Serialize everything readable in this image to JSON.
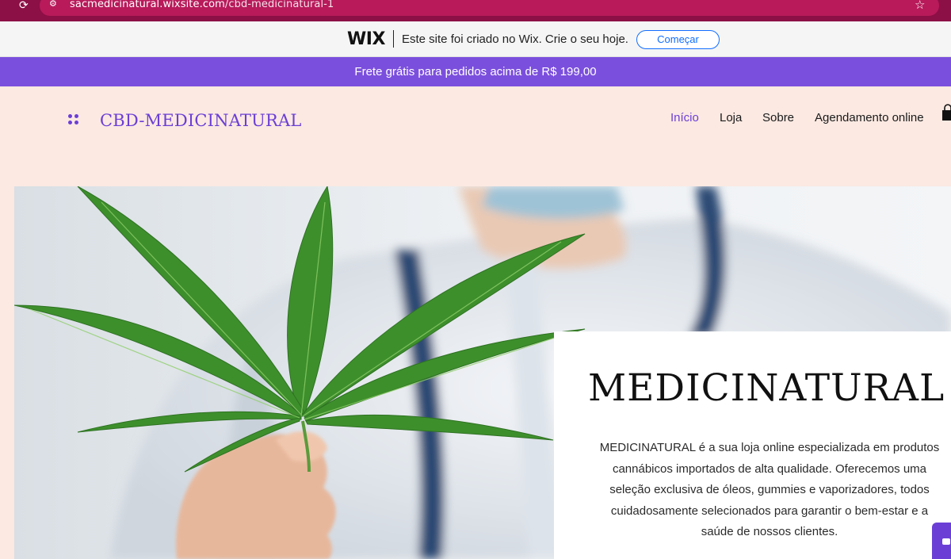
{
  "browser": {
    "url_host": "sacmedicinatural.wixsite.com",
    "url_path": "/cbd-medicinatural-1"
  },
  "wix_banner": {
    "logo": "WIX",
    "message": "Este site foi criado no Wix. Crie o seu hoje.",
    "cta_label": "Começar"
  },
  "promo": {
    "text": "Frete grátis para pedidos acima de R$ 199,00"
  },
  "header": {
    "brand": "CBD-MEDICINATURAL",
    "nav": [
      {
        "label": "Início",
        "active": true
      },
      {
        "label": "Loja",
        "active": false
      },
      {
        "label": "Sobre",
        "active": false
      },
      {
        "label": "Agendamento online",
        "active": false
      }
    ]
  },
  "hero": {
    "title": "MEDICINATURAL",
    "description": "MEDICINATURAL é a sua loja online especializada em produtos cannábicos importados de alta qualidade. Oferecemos uma seleção exclusiva de óleos, gummies e vaporizadores, todos cuidadosamente selecionados para garantir o bem-estar e a saúde de nossos clientes."
  },
  "colors": {
    "accent": "#6b3fd6",
    "promo_bg": "#7b4fdd",
    "page_bg": "#fbe9e2",
    "browser_bar": "#8c0f45"
  },
  "icons": [
    "reload-icon",
    "site-info-icon",
    "bookmark-star-icon",
    "brand-dots-icon",
    "cart-icon",
    "chat-icon"
  ]
}
